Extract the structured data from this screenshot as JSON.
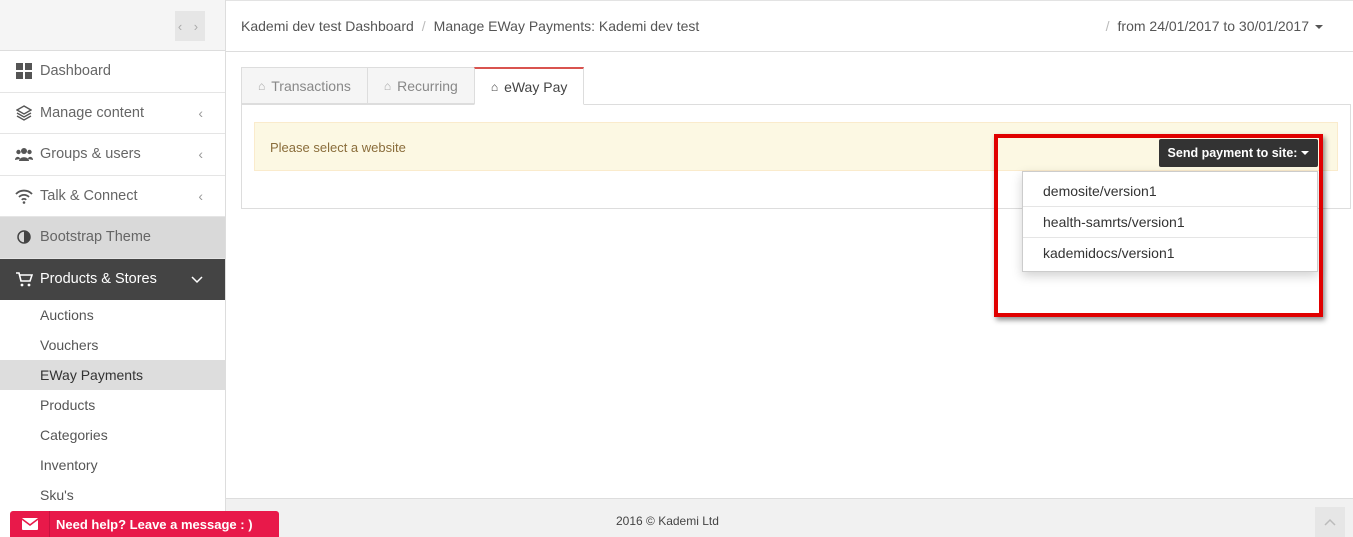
{
  "sidebar": {
    "items": [
      {
        "label": "Dashboard",
        "icon": "dashboard-icon"
      },
      {
        "label": "Manage content",
        "icon": "layers-icon"
      },
      {
        "label": "Groups & users",
        "icon": "users-icon"
      },
      {
        "label": "Talk & Connect",
        "icon": "wifi-icon"
      },
      {
        "label": "Bootstrap Theme",
        "icon": "contrast-icon"
      },
      {
        "label": "Products & Stores",
        "icon": "cart-icon"
      }
    ],
    "sub_items": [
      "Auctions",
      "Vouchers",
      "EWay Payments",
      "Products",
      "Categories",
      "Inventory",
      "Sku's"
    ]
  },
  "header": {
    "breadcrumb_1": "Kademi dev test Dashboard",
    "breadcrumb_2": "Manage EWay Payments: Kademi dev test",
    "daterange": "from 24/01/2017 to 30/01/2017"
  },
  "tabs": [
    {
      "label": "Transactions"
    },
    {
      "label": "Recurring"
    },
    {
      "label": "eWay Pay"
    }
  ],
  "alert": {
    "text": "Please select a website"
  },
  "send_button": {
    "label": "Send payment to site:"
  },
  "dropdown": {
    "options": [
      "demosite/version1",
      "health-samrts/version1",
      "kademidocs/version1"
    ]
  },
  "footer": {
    "copyright": "2016 © Kademi Ltd"
  },
  "help": {
    "label": "Need help? Leave a message : )"
  },
  "colors": {
    "accent_red": "#d9534f",
    "help_red": "#e8194a",
    "highlight_red": "#e00000",
    "active_nav": "#444444"
  }
}
